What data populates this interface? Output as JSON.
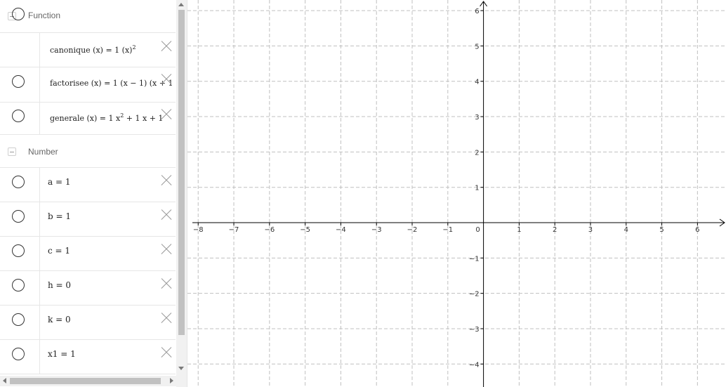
{
  "algebra": {
    "groups": {
      "function": {
        "label": "Function"
      },
      "number": {
        "label": "Number"
      }
    },
    "functions": [
      {
        "name": "canonique",
        "lhs": "canonique (x)",
        "eq": "=",
        "rhs": "1 (x)",
        "sup": "2",
        "tail": ""
      },
      {
        "name": "factorisee",
        "lhs": "factorisee (x)",
        "eq": "=",
        "rhs": "1 (x − 1) (x + 1",
        "sup": "",
        "tail": ""
      },
      {
        "name": "generale",
        "lhs": "generale (x)",
        "eq": "=",
        "rhs": "1 x",
        "sup": "2",
        "tail": " + 1 x + 1"
      }
    ],
    "numbers": [
      {
        "name": "a",
        "text": "a = 1"
      },
      {
        "name": "b",
        "text": "b = 1"
      },
      {
        "name": "c",
        "text": "c = 1"
      },
      {
        "name": "h",
        "text": "h = 0"
      },
      {
        "name": "k",
        "text": "k = 0"
      },
      {
        "name": "x1",
        "text": "x1 = 1"
      }
    ]
  },
  "graphics": {
    "x_range": [
      -8.3,
      6.8
    ],
    "y_range": [
      -4.65,
      6.3
    ],
    "x_ticks": [
      "−8",
      "−7",
      "−6",
      "−5",
      "−4",
      "−3",
      "−2",
      "−1",
      "0",
      "1",
      "2",
      "3",
      "4",
      "5",
      "6"
    ],
    "y_ticks": [
      "−4",
      "−3",
      "−2",
      "−1",
      "1",
      "2",
      "3",
      "4",
      "5",
      "6"
    ],
    "grid": true,
    "grid_color": "#c0c0c0",
    "axis_color": "#000000"
  }
}
